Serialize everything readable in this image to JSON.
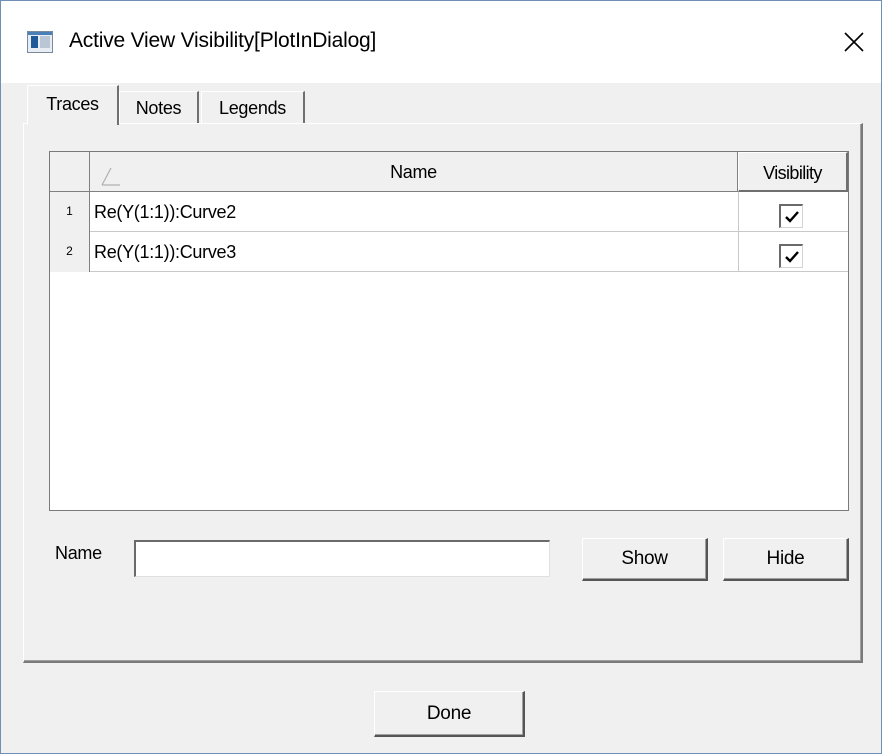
{
  "window": {
    "title": "Active View Visibility[PlotInDialog]",
    "icon": "app-window-icon",
    "close_icon": "close-icon"
  },
  "tabs": [
    {
      "label": "Traces",
      "active": true
    },
    {
      "label": "Notes",
      "active": false
    },
    {
      "label": "Legends",
      "active": false
    }
  ],
  "grid": {
    "columns": {
      "name": "Name",
      "visibility": "Visibility"
    },
    "sort_icon": "sort-indicator-icon",
    "rows": [
      {
        "index": "1",
        "name": "Re(Y(1:1)):Curve2",
        "visible": true
      },
      {
        "index": "2",
        "name": "Re(Y(1:1)):Curve3",
        "visible": true
      }
    ]
  },
  "filter": {
    "label": "Name",
    "value": "",
    "placeholder": ""
  },
  "buttons": {
    "show": "Show",
    "hide": "Hide",
    "done": "Done"
  }
}
